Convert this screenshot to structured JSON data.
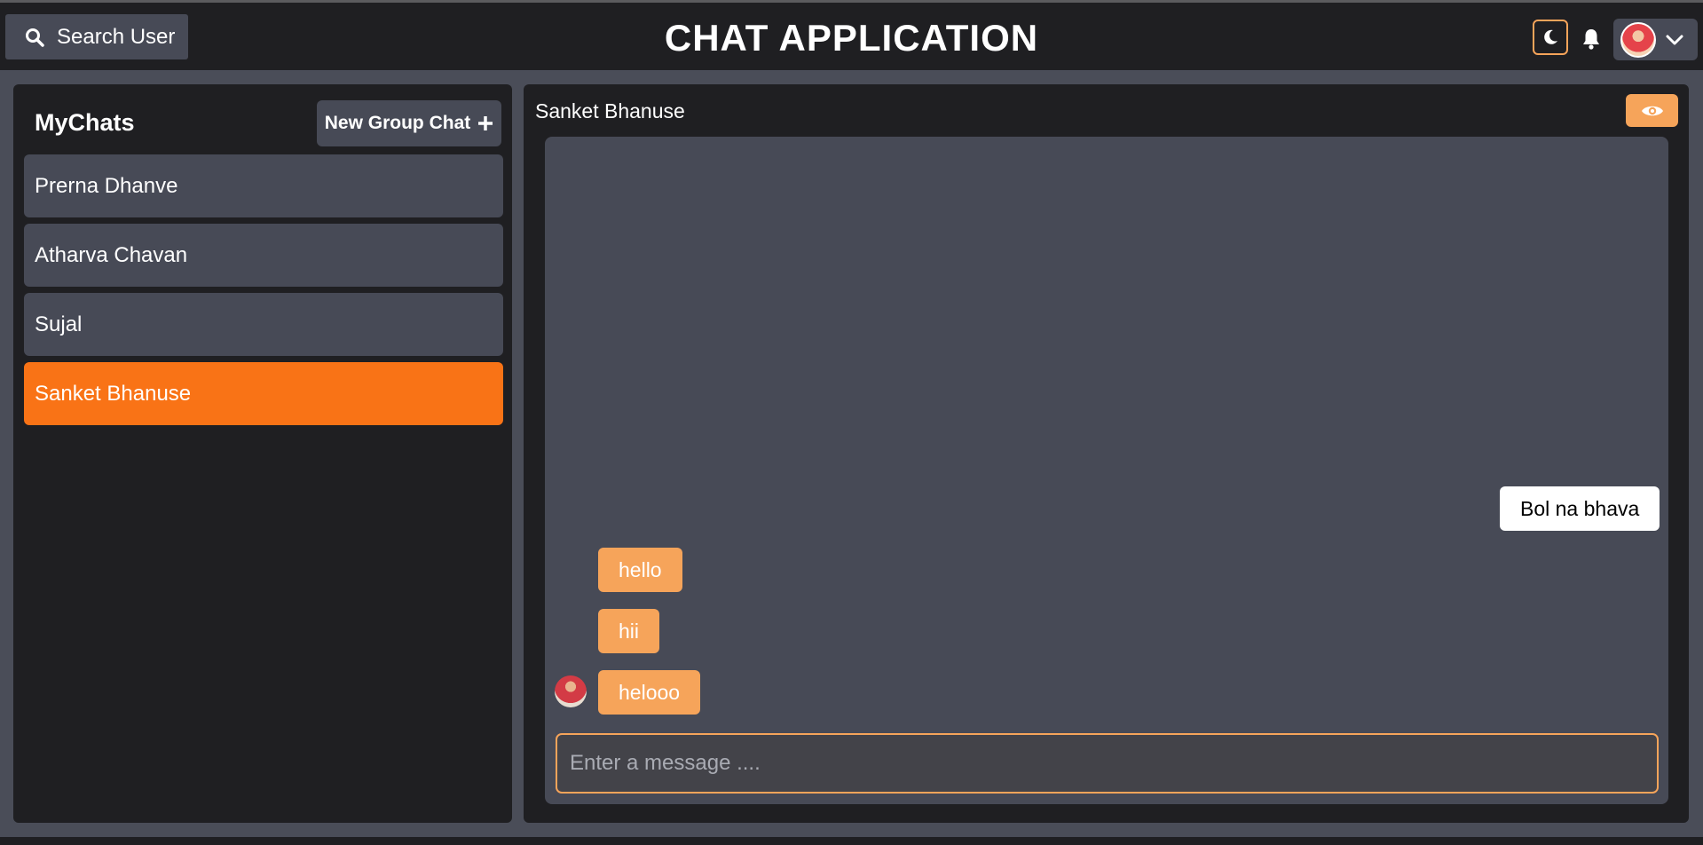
{
  "header": {
    "search_label": "Search User",
    "app_title": "CHAT APPLICATION",
    "icons": {
      "search": "search-icon",
      "theme": "moon-icon",
      "notifications": "bell-icon",
      "profile_dropdown": "chevron-down-icon"
    }
  },
  "sidebar": {
    "title": "MyChats",
    "new_group_label": "New Group Chat",
    "new_group_icon": "plus-icon",
    "chats": [
      {
        "name": "Prerna Dhanve"
      },
      {
        "name": "Atharva Chavan"
      },
      {
        "name": "Sujal"
      },
      {
        "name": "Sanket Bhanuse"
      }
    ],
    "selected_chat": "Sanket Bhanuse"
  },
  "chat": {
    "header_name": "Sanket Bhanuse",
    "view_profile_icon": "eye-icon",
    "messages": [
      {
        "text": "Bol na bhava",
        "from": "me"
      },
      {
        "text": "hello",
        "from": "other"
      },
      {
        "text": "hii",
        "from": "other"
      },
      {
        "text": "helooo",
        "from": "other"
      }
    ],
    "input_placeholder": "Enter a message ...."
  },
  "colors": {
    "accent_orange": "#f97316",
    "bubble_orange": "#f6a45a",
    "panel_dark": "#1f1f22",
    "panel_gray": "#474a56",
    "background": "#4a4d58"
  }
}
